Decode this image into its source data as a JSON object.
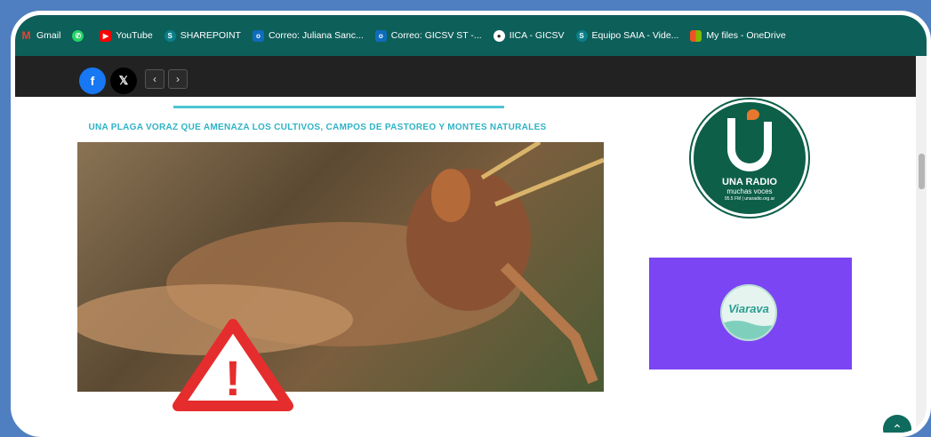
{
  "bookmarks": [
    {
      "label": "Gmail",
      "icon": "gmail-icon",
      "color": "#1e5f5a"
    },
    {
      "label": "",
      "icon": "whatsapp-icon",
      "color": "#25d366"
    },
    {
      "label": "YouTube",
      "icon": "youtube-icon",
      "color": "#ff0000"
    },
    {
      "label": "SHAREPOINT",
      "icon": "sharepoint-icon",
      "color": "#0a7f8a"
    },
    {
      "label": "Correo: Juliana Sanc...",
      "icon": "outlook-icon",
      "color": "#0f6cbd"
    },
    {
      "label": "Correo: GICSV ST -...",
      "icon": "outlook-icon",
      "color": "#0f6cbd"
    },
    {
      "label": "IICA - GICSV",
      "icon": "globe-icon",
      "color": "#2d2d2d"
    },
    {
      "label": "Equipo SAIA - Vide...",
      "icon": "sharepoint-icon",
      "color": "#0a7f8a"
    },
    {
      "label": "My files - OneDrive",
      "icon": "microsoft-icon",
      "color": "#f25022"
    }
  ],
  "article": {
    "subtitle": "UNA PLAGA VORAZ QUE AMENAZA LOS CULTIVOS, CAMPOS DE PASTOREO Y MONTES NATURALES",
    "warning_symbol": "!"
  },
  "share": {
    "facebook": "f",
    "x": "𝕏",
    "prev": "‹",
    "next": "›"
  },
  "sidebar": {
    "radio_name": "UNA RADIO",
    "radio_slogan": "muchas voces",
    "radio_small": "95.5 FM | unaradio.org.ar",
    "viarava": "Viarava"
  },
  "colors": {
    "bookmark_bar": "#0d5f5a",
    "accent_cyan": "#4ec5d3"
  }
}
